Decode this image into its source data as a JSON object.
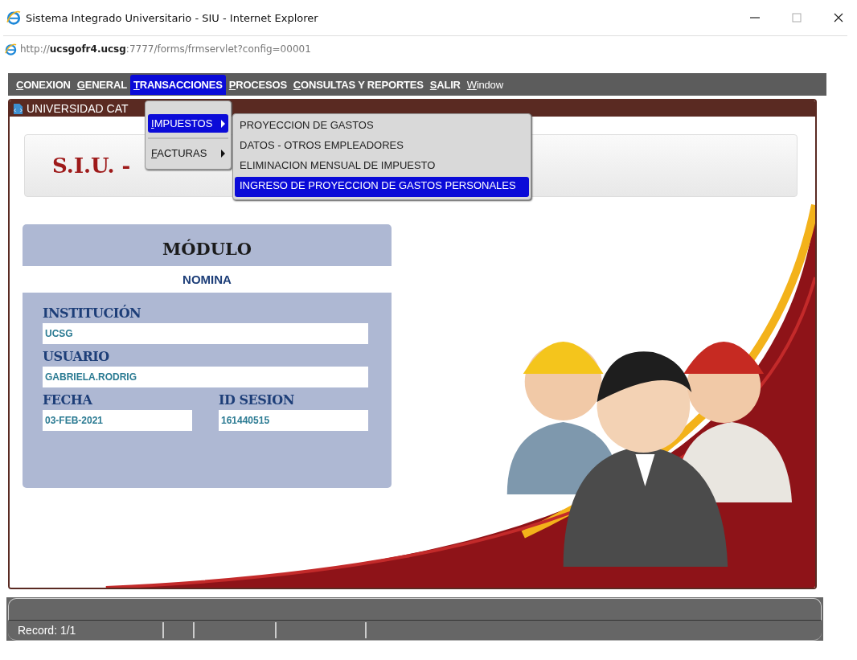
{
  "window": {
    "title": "Sistema Integrado Universitario - SIU - Internet Explorer",
    "controls": [
      {
        "kind": "minimize"
      },
      {
        "kind": "maximize"
      },
      {
        "kind": "close"
      }
    ]
  },
  "address": {
    "scheme": "http://",
    "host": "ucsgofr4.ucsg",
    "rest": ":7777/forms/frmservlet?config=00001"
  },
  "menu_bar": [
    {
      "label": "CONEXION",
      "selected": false
    },
    {
      "label": "GENERAL",
      "selected": false
    },
    {
      "label": "TRANSACCIONES",
      "selected": true
    },
    {
      "label": "PROCESOS",
      "selected": false
    },
    {
      "label": "CONSULTAS Y REPORTES",
      "selected": false
    },
    {
      "label": "SALIR",
      "selected": false
    },
    {
      "label": "Window",
      "selected": false
    }
  ],
  "menu": {
    "items": [
      {
        "label": "IMPUESTOS",
        "selected": true
      },
      {
        "label": "FACTURAS",
        "selected": false
      }
    ],
    "submenu": [
      {
        "label": "PROYECCION DE GASTOS",
        "selected": false
      },
      {
        "label": "DATOS - OTROS EMPLEADORES",
        "selected": false
      },
      {
        "label": "ELIMINACION MENSUAL DE IMPUESTO",
        "selected": false
      },
      {
        "label": "INGRESO DE PROYECCION DE GASTOS PERSONALES",
        "selected": true
      }
    ]
  },
  "form": {
    "title": "UNIVERSIDAD CAT",
    "banner": "S.I.U. -",
    "module": {
      "heading": "MÓDULO",
      "name": "NOMINA",
      "fields": [
        {
          "label": "INSTITUCIÓN",
          "value": "UCSG"
        },
        {
          "label": "USUARIO",
          "value": "GABRIELA.RODRIG"
        },
        {
          "label": "FECHA",
          "value": "03-FEB-2021"
        },
        {
          "label": "ID SESION",
          "value": "161440515"
        }
      ]
    }
  },
  "status_bar": {
    "record": "Record: 1/1"
  }
}
